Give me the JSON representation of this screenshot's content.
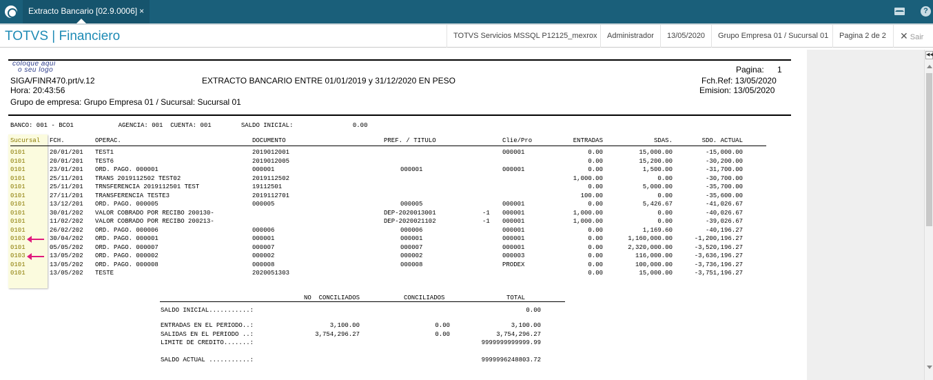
{
  "tab": {
    "title": "Extracto Bancario [02.9.0006]",
    "close": "×"
  },
  "header": {
    "app_title": "TOTVS | Financiero",
    "server": "TOTVS Servicios MSSQL P12125_mexrox",
    "user": "Administrador",
    "date": "13/05/2020",
    "company": "Grupo Empresa 01 / Sucursal 01",
    "page": "Pagina 2 de 2",
    "exit": "Sair"
  },
  "report": {
    "logo_text_1": "coloque aqui",
    "logo_text_2": "o seu logo",
    "page_label": "Pagina:",
    "page_num": "1",
    "program": "SIGA/FINR470.prt/v.12",
    "title": "EXTRACTO BANCARIO ENTRE 01/01/2019 y 31/12/2020  EN PESO",
    "fch_ref": "Fch.Ref: 13/05/2020",
    "hora": "Hora: 20:43:56",
    "emision": "Emision: 13/05/2020",
    "grupo": "Grupo de empresa: Grupo Empresa 01 / Sucursal: Sucursal 01",
    "bank_line": "BANCO: 001 - BCO1            AGENCIA: 001  CUENTA: 001        SALDO INICIAL:                0.00",
    "columns": [
      "Sucursal",
      "FCH.",
      "OPERAC.",
      "DOCUMENTO",
      "PREF. / TITULO",
      "Clie/Pro",
      "ENTRADAS",
      "SDAS.",
      "SDO. ACTUAL"
    ],
    "rows": [
      {
        "suc": "0101",
        "fch": "20/01/201",
        "op": "TEST1",
        "doc": "2019012001",
        "pref": "",
        "tit": "",
        "cli": "000001",
        "ent": "0.00",
        "sal": "15,000.00",
        "sdo": "-15,000.00"
      },
      {
        "suc": "0101",
        "fch": "20/01/201",
        "op": "TEST6",
        "doc": "2019012005",
        "pref": "",
        "tit": "",
        "cli": "",
        "ent": "0.00",
        "sal": "15,200.00",
        "sdo": "-30,200.00"
      },
      {
        "suc": "0101",
        "fch": "23/01/201",
        "op": "ORD. PAGO. 000001",
        "doc": "000001",
        "pref": "000001",
        "tit": "",
        "cli": "000001",
        "ent": "0.00",
        "sal": "1,500.00",
        "sdo": "-31,700.00"
      },
      {
        "suc": "0101",
        "fch": "25/11/201",
        "op": "TRANS 2019112502 TEST02",
        "doc": "2019112502",
        "pref": "",
        "tit": "",
        "cli": "",
        "ent": "1,000.00",
        "sal": "0.00",
        "sdo": "-30,700.00"
      },
      {
        "suc": "0101",
        "fch": "25/11/201",
        "op": "TRNSFERENCIA 2019112501 TEST",
        "doc": "19112501",
        "pref": "",
        "tit": "",
        "cli": "",
        "ent": "0.00",
        "sal": "5,000.00",
        "sdo": "-35,700.00"
      },
      {
        "suc": "0101",
        "fch": "27/11/201",
        "op": "TRANSFERENCIA TESTE3",
        "doc": "2019112701",
        "pref": "",
        "tit": "",
        "cli": "",
        "ent": "100.00",
        "sal": "0.00",
        "sdo": "-35,600.00"
      },
      {
        "suc": "0101",
        "fch": "13/12/201",
        "op": "ORD. PAGO. 000005",
        "doc": "000005",
        "pref": "000005",
        "tit": "",
        "cli": "000001",
        "ent": "0.00",
        "sal": "5,426.67",
        "sdo": "-41,026.67"
      },
      {
        "suc": "0101",
        "fch": "30/01/202",
        "op": "VALOR COBRADO POR RECIBO 200130-",
        "doc": "",
        "pref": "DEP-2020013001",
        "tit": "-1",
        "cli": "000001",
        "ent": "1,000.00",
        "sal": "0.00",
        "sdo": "-40,026.67"
      },
      {
        "suc": "0101",
        "fch": "11/02/202",
        "op": "VALOR COBRADO POR RECIBO 200213-",
        "doc": "",
        "pref": "DEP-2020021102",
        "tit": "-1",
        "cli": "000001",
        "ent": "1,000.00",
        "sal": "0.00",
        "sdo": "-39,026.67"
      },
      {
        "suc": "0101",
        "fch": "26/02/202",
        "op": "ORD. PAGO. 000006",
        "doc": "000006",
        "pref": "000006",
        "tit": "",
        "cli": "000001",
        "ent": "0.00",
        "sal": "1,169.60",
        "sdo": "-40,196.27"
      },
      {
        "suc": "0103",
        "fch": "30/04/202",
        "op": "ORD. PAGO. 000001",
        "doc": "000001",
        "pref": "000001",
        "tit": "",
        "cli": "000001",
        "ent": "0.00",
        "sal": "1,160,000.00",
        "sdo": "-1,200,196.27"
      },
      {
        "suc": "0101",
        "fch": "05/05/202",
        "op": "ORD. PAGO. 000007",
        "doc": "000007",
        "pref": "000007",
        "tit": "",
        "cli": "000001",
        "ent": "0.00",
        "sal": "2,320,000.00",
        "sdo": "-3,520,196.27"
      },
      {
        "suc": "0103",
        "fch": "13/05/202",
        "op": "ORD. PAGO. 000002",
        "doc": "000002",
        "pref": "000002",
        "tit": "",
        "cli": "000003",
        "ent": "0.00",
        "sal": "116,000.00",
        "sdo": "-3,636,196.27"
      },
      {
        "suc": "0101",
        "fch": "13/05/202",
        "op": "ORD. PAGO. 000008",
        "doc": "000008",
        "pref": "000008",
        "tit": "",
        "cli": "PRODEX",
        "ent": "0.00",
        "sal": "100,000.00",
        "sdo": "-3,736,196.27"
      },
      {
        "suc": "0101",
        "fch": "13/05/202",
        "op": "TESTE",
        "doc": "2020051303",
        "pref": "",
        "tit": "",
        "cli": "",
        "ent": "0.00",
        "sal": "15,000.00",
        "sdo": "-3,751,196.27"
      }
    ],
    "summary": {
      "headers": [
        "NO  CONCILIADOS",
        "CONCILIADOS",
        "TOTAL"
      ],
      "rows": [
        {
          "label": "SALDO INICIAL...........:",
          "nc": "",
          "c": "",
          "t": "0.00"
        },
        {
          "label": "ENTRADAS EN EL PERIODO..:",
          "nc": "3,100.00",
          "c": "0.00",
          "t": "3,100.00"
        },
        {
          "label": "SALIDAS EN EL PERIODO ..:",
          "nc": "3,754,296.27",
          "c": "0.00",
          "t": "3,754,296.27"
        },
        {
          "label": "LIMITE DE CREDITO.......:",
          "nc": "",
          "c": "",
          "t": "9999999999999.99"
        },
        {
          "label": "SALDO ACTUAL ...........:",
          "nc": "",
          "c": "",
          "t": "9999996248803.72"
        }
      ]
    }
  },
  "colors": {
    "tabbar": "#1a5f7a",
    "accent": "#1e8bb5",
    "highlight": "#fbfbde",
    "arrow": "#e0197d"
  }
}
